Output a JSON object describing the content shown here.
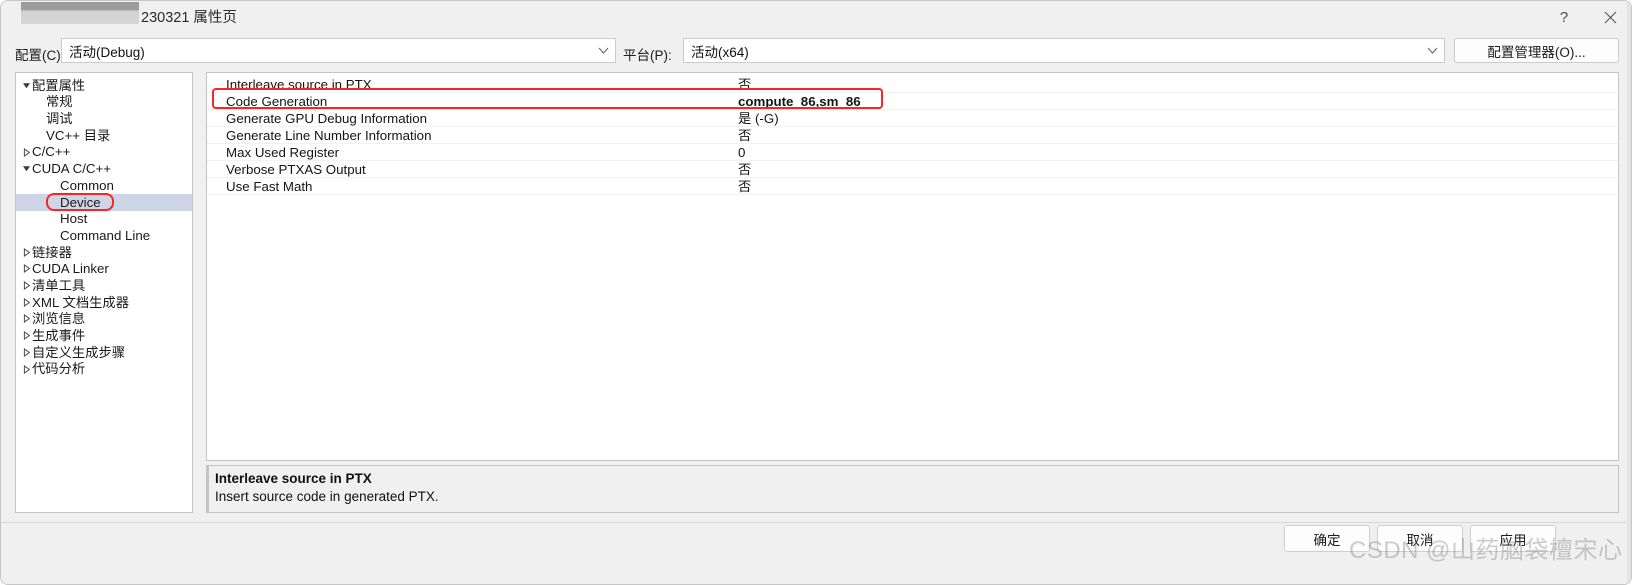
{
  "window": {
    "title": "230321 属性页",
    "redacted_title_prefix": true,
    "help_label": "?",
    "close_label": "✕"
  },
  "configbar": {
    "config_label": "配置(C):",
    "config_value": "活动(Debug)",
    "platform_label": "平台(P):",
    "platform_value": "活动(x64)",
    "config_manager_label": "配置管理器(O)..."
  },
  "tree": {
    "items": [
      {
        "label": "配置属性",
        "level": 0,
        "twisty": "expanded",
        "selected": false
      },
      {
        "label": "常规",
        "level": 1,
        "twisty": "none",
        "selected": false
      },
      {
        "label": "调试",
        "level": 1,
        "twisty": "none",
        "selected": false
      },
      {
        "label": "VC++ 目录",
        "level": 1,
        "twisty": "none",
        "selected": false
      },
      {
        "label": "C/C++",
        "level": 0,
        "twisty": "collapsed",
        "selected": false
      },
      {
        "label": "CUDA C/C++",
        "level": 0,
        "twisty": "expanded",
        "selected": false
      },
      {
        "label": "Common",
        "level": 2,
        "twisty": "none",
        "selected": false
      },
      {
        "label": "Device",
        "level": 2,
        "twisty": "none",
        "selected": true
      },
      {
        "label": "Host",
        "level": 2,
        "twisty": "none",
        "selected": false
      },
      {
        "label": "Command Line",
        "level": 2,
        "twisty": "none",
        "selected": false
      },
      {
        "label": "链接器",
        "level": 0,
        "twisty": "collapsed",
        "selected": false
      },
      {
        "label": "CUDA Linker",
        "level": 0,
        "twisty": "collapsed",
        "selected": false
      },
      {
        "label": "清单工具",
        "level": 0,
        "twisty": "collapsed",
        "selected": false
      },
      {
        "label": "XML 文档生成器",
        "level": 0,
        "twisty": "collapsed",
        "selected": false
      },
      {
        "label": "浏览信息",
        "level": 0,
        "twisty": "collapsed",
        "selected": false
      },
      {
        "label": "生成事件",
        "level": 0,
        "twisty": "collapsed",
        "selected": false
      },
      {
        "label": "自定义生成步骤",
        "level": 0,
        "twisty": "collapsed",
        "selected": false
      },
      {
        "label": "代码分析",
        "level": 0,
        "twisty": "collapsed",
        "selected": false
      }
    ]
  },
  "grid": {
    "rows": [
      {
        "name": "Interleave source in PTX",
        "value": "否",
        "bold": false
      },
      {
        "name": "Code Generation",
        "value": "compute_86,sm_86",
        "bold": true
      },
      {
        "name": "Generate GPU Debug Information",
        "value": "是 (-G)",
        "bold": false
      },
      {
        "name": "Generate Line Number Information",
        "value": "否",
        "bold": false
      },
      {
        "name": "Max Used Register",
        "value": "0",
        "bold": false
      },
      {
        "name": "Verbose PTXAS Output",
        "value": "否",
        "bold": false
      },
      {
        "name": "Use Fast Math",
        "value": "否",
        "bold": false
      }
    ],
    "annotation_color": "#fb2323",
    "annotated_row": "Code Generation"
  },
  "description": {
    "title": "Interleave source in PTX",
    "body": "Insert source code in generated PTX."
  },
  "footer": {
    "ok_label": "确定",
    "cancel_label": "取消",
    "apply_label": "应用"
  },
  "watermark": {
    "text": "CSDN @山药脑袋檀宋心"
  }
}
